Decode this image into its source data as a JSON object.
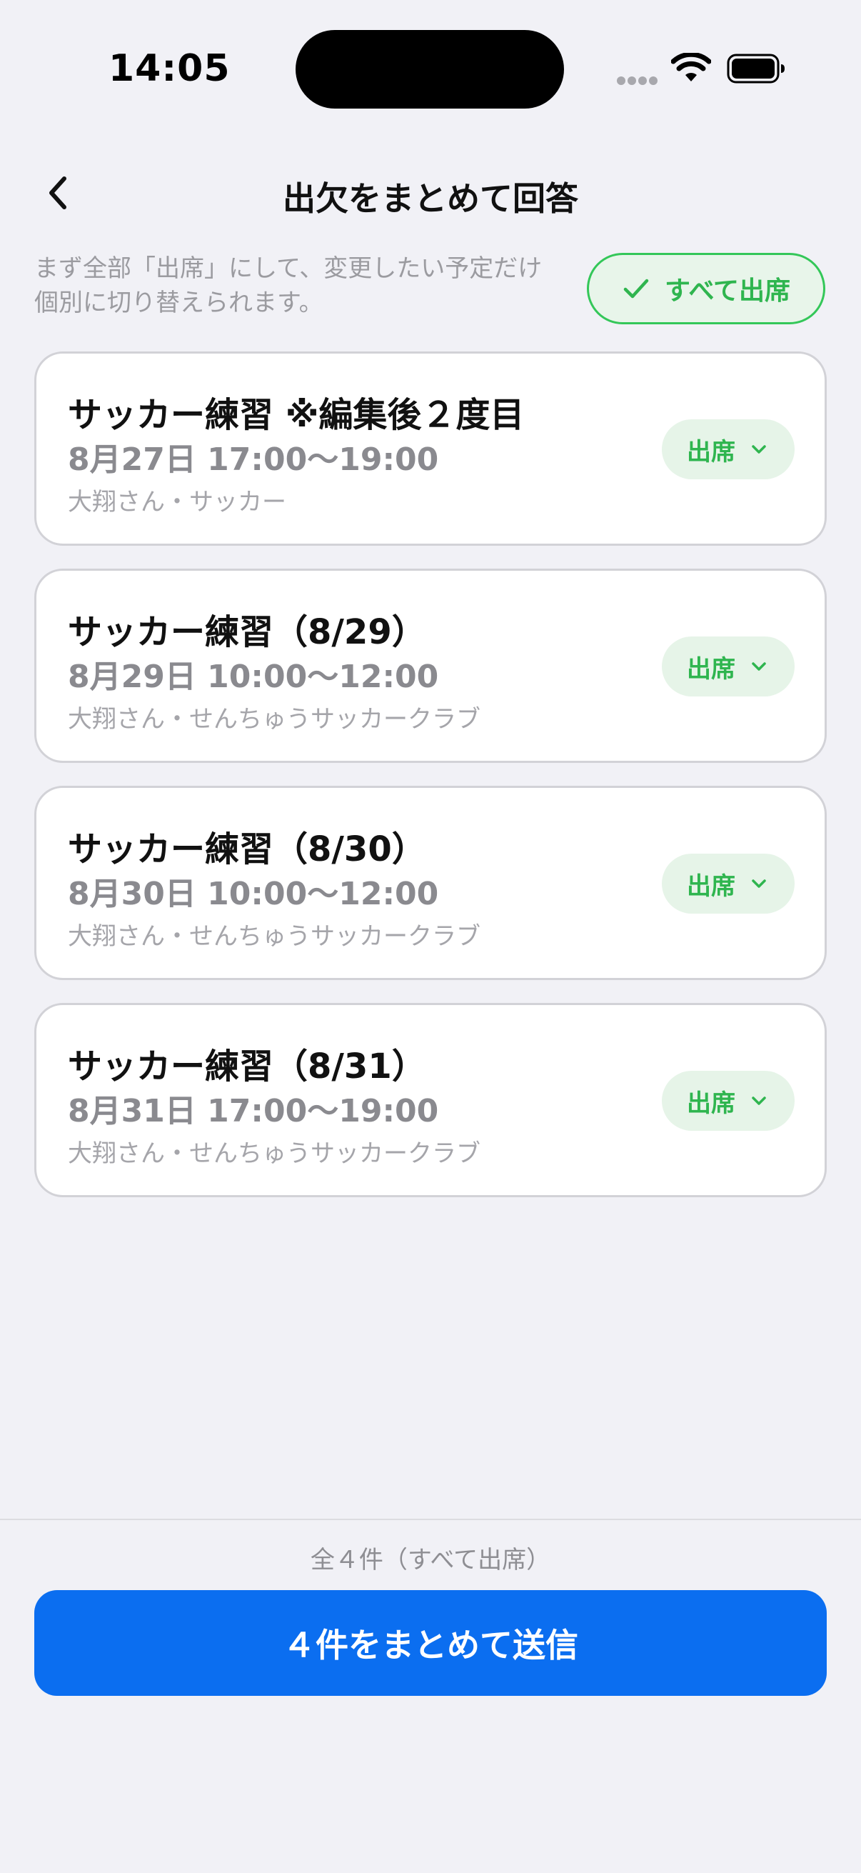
{
  "status_bar": {
    "time": "14:05"
  },
  "nav": {
    "title": "出欠をまとめて回答"
  },
  "hint": "まず全部「出席」にして、変更したい予定だけ個別に切り替えられます。",
  "all_attend_label": "すべて出席",
  "events": [
    {
      "title": "サッカー練習 ※編集後２度目",
      "datetime": "8月27日 17:00〜19:00",
      "meta": "大翔さん・サッカー",
      "status": "出席"
    },
    {
      "title": "サッカー練習（8/29）",
      "datetime": "8月29日 10:00〜12:00",
      "meta": "大翔さん・せんちゅうサッカークラブ",
      "status": "出席"
    },
    {
      "title": "サッカー練習（8/30）",
      "datetime": "8月30日 10:00〜12:00",
      "meta": "大翔さん・せんちゅうサッカークラブ",
      "status": "出席"
    },
    {
      "title": "サッカー練習（8/31）",
      "datetime": "8月31日 17:00〜19:00",
      "meta": "大翔さん・せんちゅうサッカークラブ",
      "status": "出席"
    }
  ],
  "summary": "全４件（すべて出席）",
  "submit_label": "４件をまとめて送信",
  "colors": {
    "accent_blue": "#0b6ef0",
    "attend_green": "#34c759",
    "background": "#f1f1f6"
  }
}
